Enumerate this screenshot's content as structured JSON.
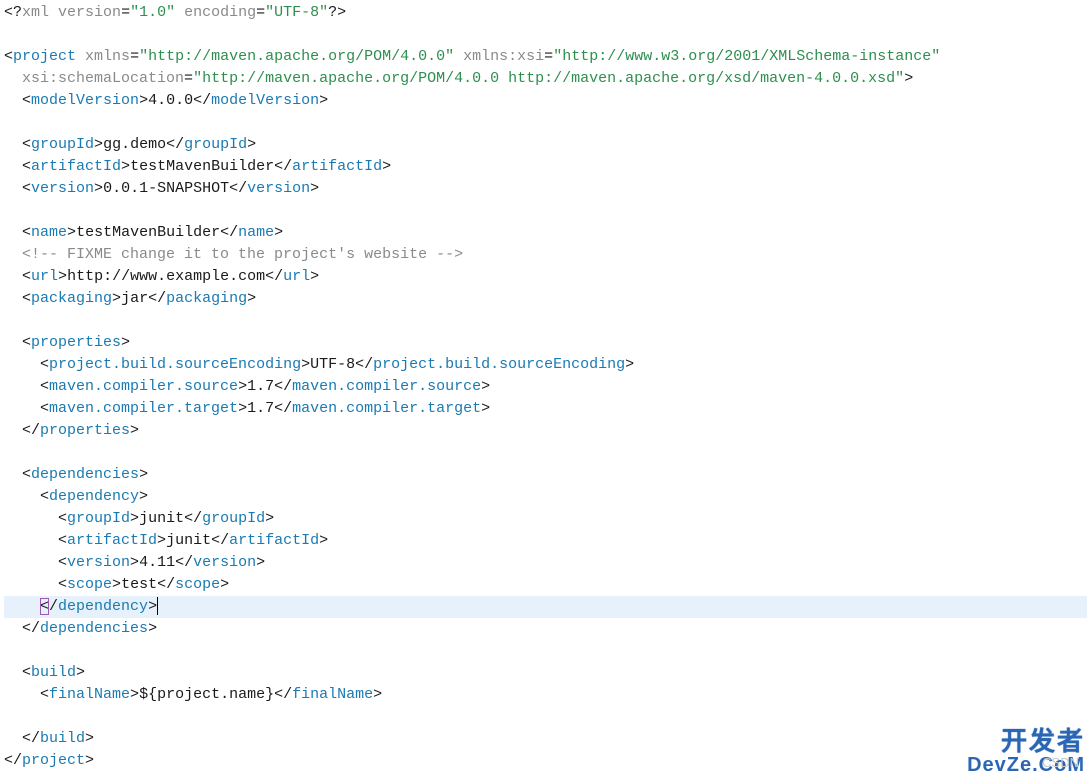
{
  "xml_decl": {
    "version": "1.0",
    "encoding": "UTF-8"
  },
  "project": {
    "xmlns": "http://maven.apache.org/POM/4.0.0",
    "xmlns_xsi": "http://www.w3.org/2001/XMLSchema-instance",
    "xsi_schemaLocation": "http://maven.apache.org/POM/4.0.0 http://maven.apache.org/xsd/maven-4.0.0.xsd",
    "modelVersion": "4.0.0",
    "groupId": "gg.demo",
    "artifactId": "testMavenBuilder",
    "version": "0.0.1-SNAPSHOT",
    "name": "testMavenBuilder",
    "comment": " FIXME change it to the project's website ",
    "url": "http://www.example.com",
    "packaging": "jar",
    "properties": {
      "project.build.sourceEncoding": "UTF-8",
      "maven.compiler.source": "1.7",
      "maven.compiler.target": "1.7"
    },
    "dependencies": [
      {
        "groupId": "junit",
        "artifactId": "junit",
        "version": "4.11",
        "scope": "test"
      }
    ],
    "build": {
      "finalName": "${project.name}"
    }
  },
  "watermarks": {
    "csdn": "CSDN",
    "devze_cn": "开发者",
    "devze_en": "DevZe.CoM"
  }
}
